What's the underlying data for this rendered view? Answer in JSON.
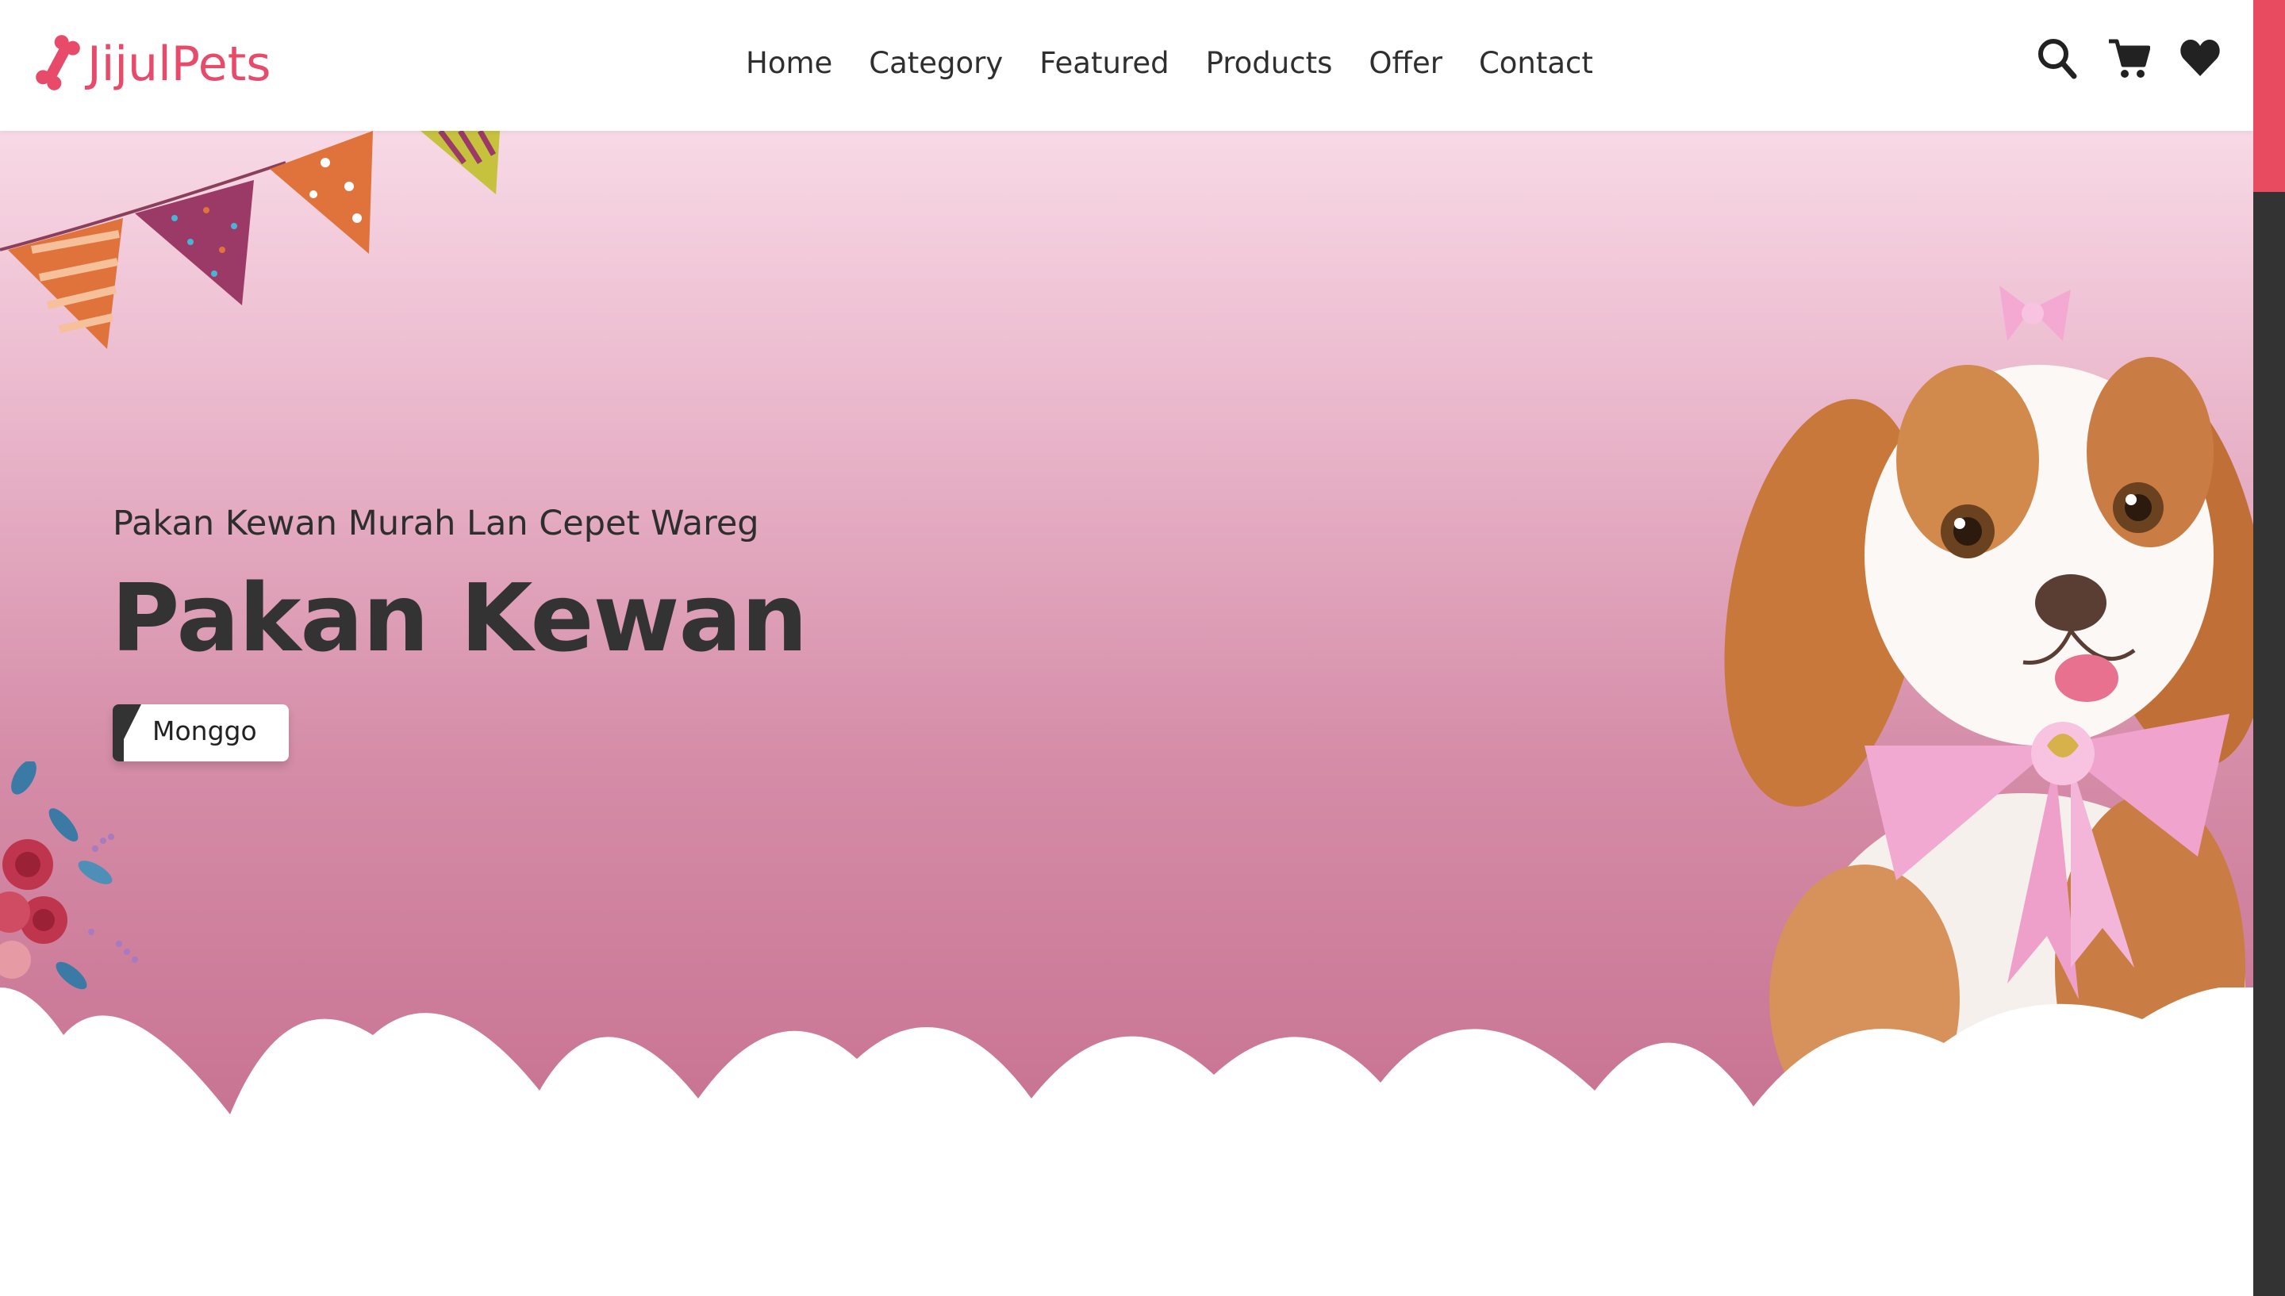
{
  "brand": {
    "name": "JijulPets",
    "color": "#e84a6a",
    "logo_icon": "bone-icon"
  },
  "nav": {
    "items": [
      {
        "label": "Home"
      },
      {
        "label": "Category"
      },
      {
        "label": "Featured"
      },
      {
        "label": "Products"
      },
      {
        "label": "Offer"
      },
      {
        "label": "Contact"
      }
    ]
  },
  "header_icons": [
    "search-icon",
    "cart-icon",
    "heart-icon"
  ],
  "hero": {
    "subtitle": "Pakan Kewan Murah Lan Cepet Wareg",
    "title": "Pakan Kewan",
    "button_label": "Monggo",
    "gradient_top": "#f8d9e6",
    "gradient_bottom": "#c6708f"
  },
  "scrollbar": {
    "track_color": "#333333",
    "thumb_color": "#e84a5f"
  }
}
